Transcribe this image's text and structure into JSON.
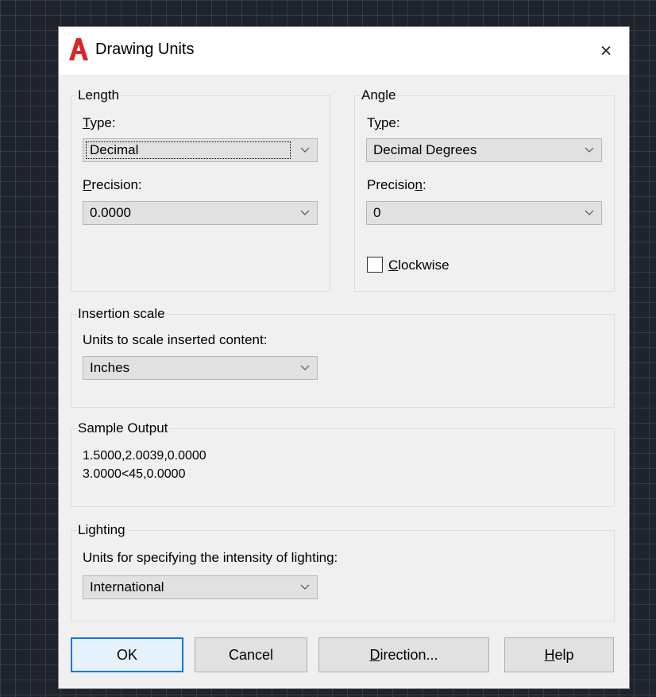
{
  "dialog": {
    "title": "Drawing Units",
    "close_glyph": "×",
    "icon": "autocad-a-icon"
  },
  "length": {
    "group_label": "Length",
    "type_label_prefix": "",
    "type_label_mnemonic": "T",
    "type_label_rest": "ype:",
    "type_value": "Decimal",
    "precision_label_mnemonic": "P",
    "precision_label_rest": "recision:",
    "precision_value": "0.0000"
  },
  "angle": {
    "group_label": "Angle",
    "type_label_prefix": "T",
    "type_label_mnemonic": "y",
    "type_label_rest": "pe:",
    "type_value": "Decimal Degrees",
    "precision_label_prefix": "Precisio",
    "precision_label_mnemonic": "n",
    "precision_label_rest": ":",
    "precision_value": "0",
    "clockwise_mnemonic": "C",
    "clockwise_rest": "lockwise",
    "clockwise_checked": false
  },
  "insertion": {
    "group_label": "Insertion scale",
    "label": "Units to scale inserted content:",
    "value": "Inches"
  },
  "sample": {
    "group_label": "Sample Output",
    "line1": "1.5000,2.0039,0.0000",
    "line2": "3.0000<45,0.0000"
  },
  "lighting": {
    "group_label": "Lighting",
    "label": "Units for specifying the intensity of lighting:",
    "value": "International"
  },
  "buttons": {
    "ok": "OK",
    "cancel": "Cancel",
    "direction_mnemonic": "D",
    "direction_rest": "irection...",
    "help_mnemonic": "H",
    "help_rest": "elp"
  },
  "colors": {
    "accent": "#0078d7",
    "logo_red": "#d8252b",
    "dialog_bg": "#f0f0f0",
    "canvas_bg": "#1f232b"
  }
}
